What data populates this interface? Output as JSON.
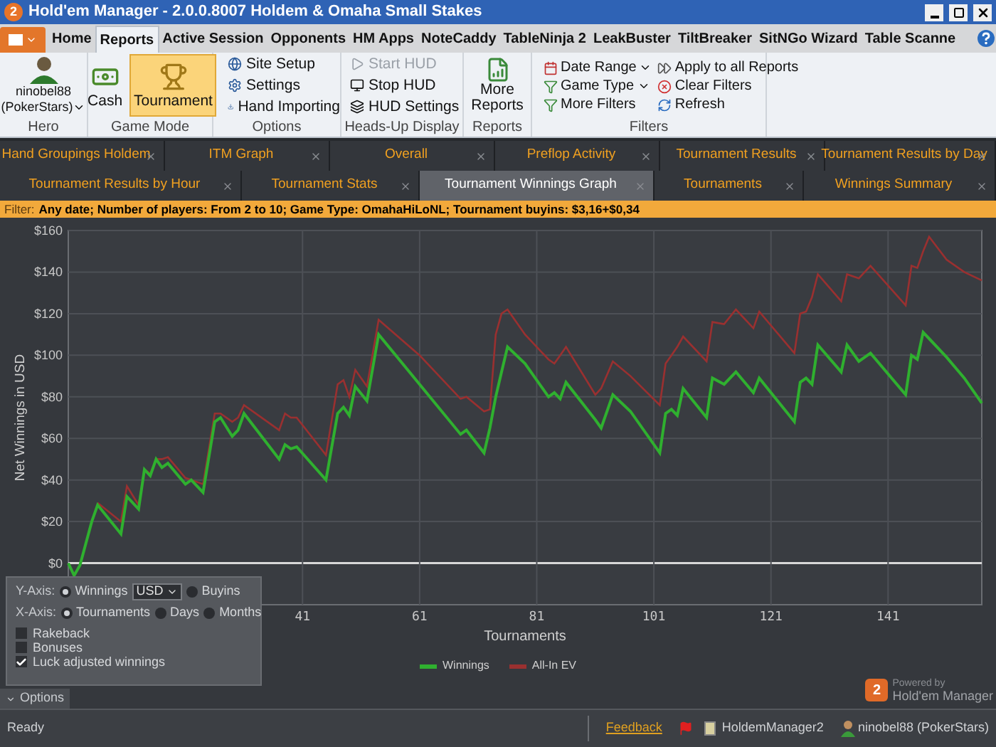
{
  "window": {
    "icon": "2",
    "title": "Hold'em Manager - 2.0.0.8007 Holdem & Omaha Small Stakes"
  },
  "ribbon_tabs": [
    {
      "label": "Home",
      "selected": false
    },
    {
      "label": "Reports",
      "selected": true
    },
    {
      "label": "Active Session",
      "selected": false
    },
    {
      "label": "Opponents",
      "selected": false
    },
    {
      "label": "HM Apps",
      "selected": false
    },
    {
      "label": "NoteCaddy",
      "selected": false
    },
    {
      "label": "TableNinja 2",
      "selected": false
    },
    {
      "label": "LeakBuster",
      "selected": false
    },
    {
      "label": "TiltBreaker",
      "selected": false
    },
    {
      "label": "SitNGo Wizard",
      "selected": false
    },
    {
      "label": "Table Scanne",
      "selected": false
    }
  ],
  "ribbon": {
    "hero": {
      "group": "Hero",
      "name": "ninobel88",
      "site": "(PokerStars)"
    },
    "game_mode": {
      "group": "Game Mode",
      "items": [
        {
          "label": "Cash",
          "selected": false
        },
        {
          "label": "Tournament",
          "selected": true
        }
      ]
    },
    "options": {
      "group": "Options",
      "items": [
        {
          "label": "Site Setup"
        },
        {
          "label": "Settings"
        },
        {
          "label": "Hand Importing"
        }
      ]
    },
    "hud": {
      "group": "Heads-Up Display",
      "items": [
        {
          "label": "Start HUD",
          "disabled": true
        },
        {
          "label": "Stop HUD",
          "disabled": false
        },
        {
          "label": "HUD Settings",
          "disabled": false
        }
      ]
    },
    "reports": {
      "group": "Reports",
      "button": "More Reports"
    },
    "filters": {
      "group": "Filters",
      "items": [
        {
          "label": "Date Range",
          "dropdown": true
        },
        {
          "label": "Game Type",
          "dropdown": true
        },
        {
          "label": "More Filters",
          "dropdown": false
        },
        {
          "label": "Apply to all Reports",
          "dropdown": false
        },
        {
          "label": "Clear Filters",
          "dropdown": false
        },
        {
          "label": "Refresh",
          "dropdown": false
        }
      ]
    }
  },
  "report_tabs": [
    {
      "tabs": [
        {
          "label": "Hand Groupings Holdem",
          "selected": false
        },
        {
          "label": "ITM Graph",
          "selected": false
        },
        {
          "label": "Overall",
          "selected": false
        },
        {
          "label": "Preflop Activity",
          "selected": false
        },
        {
          "label": "Tournament Results",
          "selected": false
        },
        {
          "label": "Tournament Results by Day",
          "selected": false
        }
      ]
    },
    {
      "tabs": [
        {
          "label": "Tournament Results by Hour",
          "selected": false
        },
        {
          "label": "Tournament Stats",
          "selected": false
        },
        {
          "label": "Tournament Winnings Graph",
          "selected": true
        },
        {
          "label": "Tournaments",
          "selected": false
        },
        {
          "label": "Winnings Summary",
          "selected": false
        }
      ]
    }
  ],
  "filter": {
    "label": "Filter:",
    "text": "Any date; Number of players: From 2 to 10; Game Type: OmahaHiLoNL; Tournament buyins: $3,16+$0,34"
  },
  "chart": {
    "chart_data": {
      "type": "line",
      "grid": true,
      "legend": true,
      "xlabel": "Tournaments",
      "ylabel": "Net Winnings in USD",
      "xlim": [
        1,
        157
      ],
      "ylim": [
        -20,
        160
      ],
      "xticks": [
        41,
        61,
        81,
        101,
        121,
        141
      ],
      "yticks": [
        {
          "value": 0,
          "label": "$0"
        },
        {
          "value": 20,
          "label": "$20"
        },
        {
          "value": 40,
          "label": "$40"
        },
        {
          "value": 60,
          "label": "$60"
        },
        {
          "value": 80,
          "label": "$80"
        },
        {
          "value": 100,
          "label": "$100"
        },
        {
          "value": 120,
          "label": "$120"
        },
        {
          "value": 140,
          "label": "$140"
        },
        {
          "value": 160,
          "label": "$160"
        }
      ],
      "x": [
        1,
        2,
        3,
        5,
        6,
        10,
        11,
        13,
        14,
        15,
        16,
        17,
        18,
        21,
        22,
        24,
        26,
        27,
        29,
        30,
        31,
        37,
        38,
        39,
        40,
        45,
        47,
        48,
        49,
        50,
        52,
        54,
        61,
        68,
        69,
        72,
        73,
        74,
        75,
        76,
        79,
        83,
        84,
        85,
        86,
        91,
        92,
        94,
        97,
        102,
        103,
        104,
        105,
        106,
        110,
        111,
        113,
        115,
        118,
        119,
        125,
        126,
        127,
        128,
        129,
        133,
        134,
        136,
        138,
        144,
        145,
        146,
        147,
        148,
        151,
        154,
        157
      ],
      "series": [
        {
          "name": "Winnings",
          "color": "#2fb02f",
          "values": [
            0,
            -6,
            -1,
            20,
            28,
            14,
            32,
            26,
            45,
            42,
            50,
            46,
            48,
            38,
            40,
            34,
            68,
            70,
            61,
            64,
            72,
            50,
            57,
            55,
            56,
            40,
            72,
            75,
            71,
            85,
            78,
            110,
            86,
            62,
            64,
            53,
            65,
            80,
            92,
            104,
            96,
            80,
            82,
            79,
            87,
            69,
            65,
            81,
            73,
            53,
            72,
            74,
            71,
            84,
            70,
            89,
            86,
            92,
            82,
            89,
            68,
            87,
            89,
            86,
            105,
            92,
            105,
            97,
            101,
            81,
            100,
            98,
            111,
            108,
            99,
            89,
            77
          ]
        },
        {
          "name": "All-In EV",
          "color": "#9a3030",
          "values": [
            null,
            null,
            null,
            null,
            29,
            20,
            37,
            28,
            45,
            43,
            50,
            50,
            51,
            41,
            40,
            38,
            72,
            72,
            68,
            70,
            76,
            64,
            72,
            70,
            70,
            52,
            86,
            88,
            80,
            93,
            85,
            117,
            100,
            79,
            80,
            73,
            74,
            110,
            120,
            122,
            110,
            98,
            96,
            100,
            104,
            81,
            84,
            97,
            90,
            76,
            96,
            100,
            104,
            109,
            97,
            116,
            115,
            122,
            113,
            121,
            101,
            120,
            121,
            128,
            139,
            126,
            139,
            137,
            143,
            124,
            143,
            142,
            150,
            157,
            146,
            140,
            136
          ]
        }
      ]
    }
  },
  "options_panel": {
    "y_axis": {
      "label": "Y-Axis:",
      "options": [
        {
          "label": "Winnings",
          "selected": true
        },
        {
          "label": "Buyins",
          "selected": false
        }
      ],
      "currency": "USD"
    },
    "x_axis": {
      "label": "X-Axis:",
      "options": [
        {
          "label": "Tournaments",
          "selected": true
        },
        {
          "label": "Days",
          "selected": false
        },
        {
          "label": "Months",
          "selected": false
        }
      ]
    },
    "checkboxes": [
      {
        "label": "Rakeback",
        "checked": false
      },
      {
        "label": "Bonuses",
        "checked": false
      },
      {
        "label": "Luck adjusted winnings",
        "checked": true
      }
    ],
    "toggle": "Options"
  },
  "branding": {
    "logo": "2",
    "powered_by": "Powered by",
    "name": "Hold'em Manager"
  },
  "status_bar": {
    "text": "Ready",
    "feedback": "Feedback",
    "app": "HoldemManager2",
    "user": "ninobel88 (PokerStars)"
  }
}
